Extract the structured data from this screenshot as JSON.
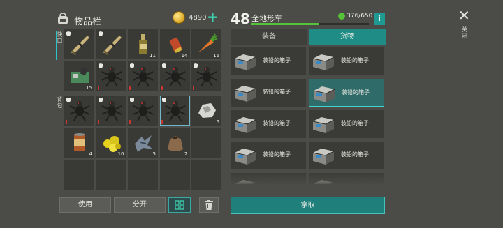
{
  "inventory": {
    "title": "物品栏",
    "coins": "4890",
    "add_icon": "plus-icon",
    "side_labels": {
      "quick": "快\n口",
      "backpack": "背\n包"
    },
    "rows": [
      [
        {
          "item": "rifle",
          "shield": true
        },
        {
          "item": "rifle",
          "shield": true
        },
        {
          "item": "bottle",
          "count": "11"
        },
        {
          "item": "shell",
          "count": "14"
        },
        {
          "item": "carrot",
          "count": "16"
        }
      ],
      [
        {
          "item": "device",
          "count": "15"
        },
        {
          "item": "ant",
          "shield": true
        },
        {
          "item": "ant",
          "shield": true
        },
        {
          "item": "ant",
          "shield": true
        },
        {
          "item": "ant",
          "shield": true
        }
      ],
      [
        {
          "item": "ant",
          "shield": true
        },
        {
          "item": "ant",
          "shield": true
        },
        {
          "item": "ant",
          "shield": true
        },
        {
          "item": "ant",
          "shield": true,
          "hl": true
        },
        {
          "item": "ore",
          "count": "6"
        }
      ],
      [
        {
          "item": "can",
          "count": "4"
        },
        {
          "item": "gold",
          "count": "10"
        },
        {
          "item": "scrap",
          "count": "5"
        },
        {
          "item": "sack",
          "count": "2"
        },
        {}
      ],
      [
        {},
        {},
        {},
        {},
        {}
      ]
    ],
    "buttons": {
      "use": "使用",
      "split": "分开"
    },
    "sort_icon": "grid-sort-icon",
    "trash_icon": "trash-icon"
  },
  "vehicle": {
    "level": "48",
    "name": "全地形车",
    "capacity": "376/650",
    "capacity_fraction": 0.578,
    "info": "i",
    "tabs": {
      "equipment": "装备",
      "cargo": "货物"
    },
    "items": [
      {
        "label": "装铅的箱子"
      },
      {
        "label": "装铅的箱子"
      },
      {
        "label": "装铅的箱子"
      },
      {
        "label": "装铅的箱子",
        "selected": true
      },
      {
        "label": "装铅的箱子"
      },
      {
        "label": "装铅的箱子"
      },
      {
        "label": "装铅的箱子"
      },
      {
        "label": "装铅的箱子"
      },
      {
        "label": ""
      },
      {
        "label": ""
      }
    ],
    "take_button": "拿取"
  },
  "close": {
    "icon": "close-icon",
    "label": "关\n闭"
  },
  "colors": {
    "accent": "#1f8c86",
    "capacity_bar": "#56c23a",
    "durability": "#c8342e"
  }
}
